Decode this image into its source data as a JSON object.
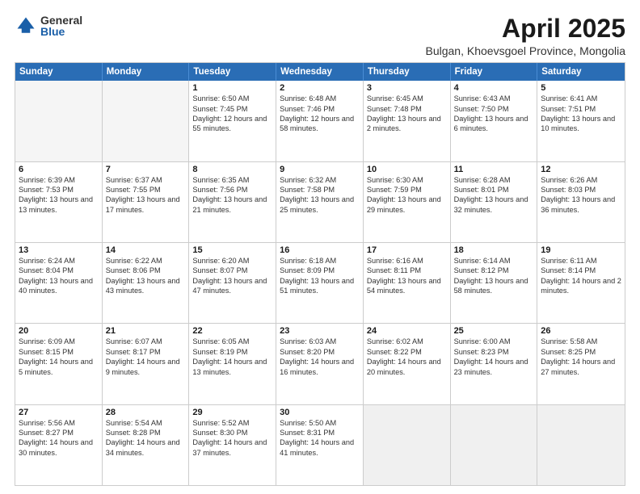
{
  "logo": {
    "general": "General",
    "blue": "Blue"
  },
  "header": {
    "month": "April 2025",
    "location": "Bulgan, Khoevsgoel Province, Mongolia"
  },
  "weekdays": [
    "Sunday",
    "Monday",
    "Tuesday",
    "Wednesday",
    "Thursday",
    "Friday",
    "Saturday"
  ],
  "weeks": [
    [
      {
        "day": "",
        "sunrise": "",
        "sunset": "",
        "daylight": "",
        "empty": true
      },
      {
        "day": "",
        "sunrise": "",
        "sunset": "",
        "daylight": "",
        "empty": true
      },
      {
        "day": "1",
        "sunrise": "Sunrise: 6:50 AM",
        "sunset": "Sunset: 7:45 PM",
        "daylight": "Daylight: 12 hours and 55 minutes."
      },
      {
        "day": "2",
        "sunrise": "Sunrise: 6:48 AM",
        "sunset": "Sunset: 7:46 PM",
        "daylight": "Daylight: 12 hours and 58 minutes."
      },
      {
        "day": "3",
        "sunrise": "Sunrise: 6:45 AM",
        "sunset": "Sunset: 7:48 PM",
        "daylight": "Daylight: 13 hours and 2 minutes."
      },
      {
        "day": "4",
        "sunrise": "Sunrise: 6:43 AM",
        "sunset": "Sunset: 7:50 PM",
        "daylight": "Daylight: 13 hours and 6 minutes."
      },
      {
        "day": "5",
        "sunrise": "Sunrise: 6:41 AM",
        "sunset": "Sunset: 7:51 PM",
        "daylight": "Daylight: 13 hours and 10 minutes."
      }
    ],
    [
      {
        "day": "6",
        "sunrise": "Sunrise: 6:39 AM",
        "sunset": "Sunset: 7:53 PM",
        "daylight": "Daylight: 13 hours and 13 minutes."
      },
      {
        "day": "7",
        "sunrise": "Sunrise: 6:37 AM",
        "sunset": "Sunset: 7:55 PM",
        "daylight": "Daylight: 13 hours and 17 minutes."
      },
      {
        "day": "8",
        "sunrise": "Sunrise: 6:35 AM",
        "sunset": "Sunset: 7:56 PM",
        "daylight": "Daylight: 13 hours and 21 minutes."
      },
      {
        "day": "9",
        "sunrise": "Sunrise: 6:32 AM",
        "sunset": "Sunset: 7:58 PM",
        "daylight": "Daylight: 13 hours and 25 minutes."
      },
      {
        "day": "10",
        "sunrise": "Sunrise: 6:30 AM",
        "sunset": "Sunset: 7:59 PM",
        "daylight": "Daylight: 13 hours and 29 minutes."
      },
      {
        "day": "11",
        "sunrise": "Sunrise: 6:28 AM",
        "sunset": "Sunset: 8:01 PM",
        "daylight": "Daylight: 13 hours and 32 minutes."
      },
      {
        "day": "12",
        "sunrise": "Sunrise: 6:26 AM",
        "sunset": "Sunset: 8:03 PM",
        "daylight": "Daylight: 13 hours and 36 minutes."
      }
    ],
    [
      {
        "day": "13",
        "sunrise": "Sunrise: 6:24 AM",
        "sunset": "Sunset: 8:04 PM",
        "daylight": "Daylight: 13 hours and 40 minutes."
      },
      {
        "day": "14",
        "sunrise": "Sunrise: 6:22 AM",
        "sunset": "Sunset: 8:06 PM",
        "daylight": "Daylight: 13 hours and 43 minutes."
      },
      {
        "day": "15",
        "sunrise": "Sunrise: 6:20 AM",
        "sunset": "Sunset: 8:07 PM",
        "daylight": "Daylight: 13 hours and 47 minutes."
      },
      {
        "day": "16",
        "sunrise": "Sunrise: 6:18 AM",
        "sunset": "Sunset: 8:09 PM",
        "daylight": "Daylight: 13 hours and 51 minutes."
      },
      {
        "day": "17",
        "sunrise": "Sunrise: 6:16 AM",
        "sunset": "Sunset: 8:11 PM",
        "daylight": "Daylight: 13 hours and 54 minutes."
      },
      {
        "day": "18",
        "sunrise": "Sunrise: 6:14 AM",
        "sunset": "Sunset: 8:12 PM",
        "daylight": "Daylight: 13 hours and 58 minutes."
      },
      {
        "day": "19",
        "sunrise": "Sunrise: 6:11 AM",
        "sunset": "Sunset: 8:14 PM",
        "daylight": "Daylight: 14 hours and 2 minutes."
      }
    ],
    [
      {
        "day": "20",
        "sunrise": "Sunrise: 6:09 AM",
        "sunset": "Sunset: 8:15 PM",
        "daylight": "Daylight: 14 hours and 5 minutes."
      },
      {
        "day": "21",
        "sunrise": "Sunrise: 6:07 AM",
        "sunset": "Sunset: 8:17 PM",
        "daylight": "Daylight: 14 hours and 9 minutes."
      },
      {
        "day": "22",
        "sunrise": "Sunrise: 6:05 AM",
        "sunset": "Sunset: 8:19 PM",
        "daylight": "Daylight: 14 hours and 13 minutes."
      },
      {
        "day": "23",
        "sunrise": "Sunrise: 6:03 AM",
        "sunset": "Sunset: 8:20 PM",
        "daylight": "Daylight: 14 hours and 16 minutes."
      },
      {
        "day": "24",
        "sunrise": "Sunrise: 6:02 AM",
        "sunset": "Sunset: 8:22 PM",
        "daylight": "Daylight: 14 hours and 20 minutes."
      },
      {
        "day": "25",
        "sunrise": "Sunrise: 6:00 AM",
        "sunset": "Sunset: 8:23 PM",
        "daylight": "Daylight: 14 hours and 23 minutes."
      },
      {
        "day": "26",
        "sunrise": "Sunrise: 5:58 AM",
        "sunset": "Sunset: 8:25 PM",
        "daylight": "Daylight: 14 hours and 27 minutes."
      }
    ],
    [
      {
        "day": "27",
        "sunrise": "Sunrise: 5:56 AM",
        "sunset": "Sunset: 8:27 PM",
        "daylight": "Daylight: 14 hours and 30 minutes."
      },
      {
        "day": "28",
        "sunrise": "Sunrise: 5:54 AM",
        "sunset": "Sunset: 8:28 PM",
        "daylight": "Daylight: 14 hours and 34 minutes."
      },
      {
        "day": "29",
        "sunrise": "Sunrise: 5:52 AM",
        "sunset": "Sunset: 8:30 PM",
        "daylight": "Daylight: 14 hours and 37 minutes."
      },
      {
        "day": "30",
        "sunrise": "Sunrise: 5:50 AM",
        "sunset": "Sunset: 8:31 PM",
        "daylight": "Daylight: 14 hours and 41 minutes."
      },
      {
        "day": "",
        "sunrise": "",
        "sunset": "",
        "daylight": "",
        "empty": true,
        "shaded": true
      },
      {
        "day": "",
        "sunrise": "",
        "sunset": "",
        "daylight": "",
        "empty": true,
        "shaded": true
      },
      {
        "day": "",
        "sunrise": "",
        "sunset": "",
        "daylight": "",
        "empty": true,
        "shaded": true
      }
    ]
  ]
}
